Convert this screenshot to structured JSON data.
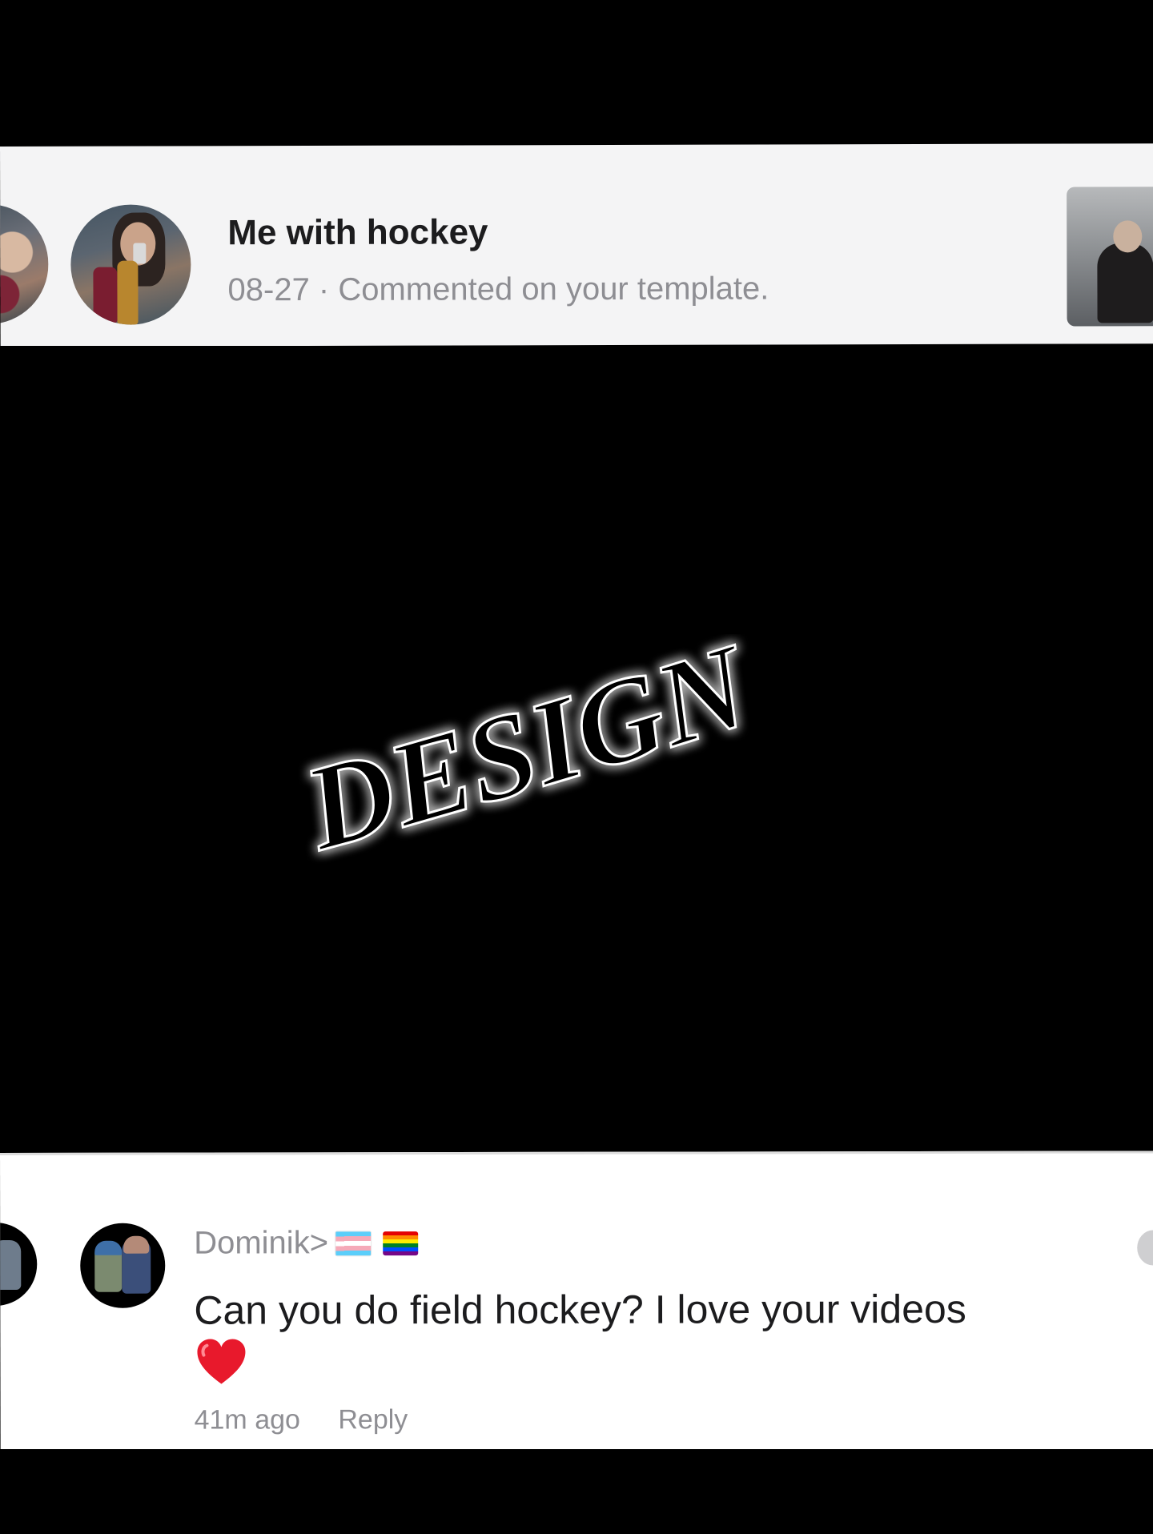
{
  "notification": {
    "title": "Me with hockey",
    "subtitle": "08-27 · Commented on your template.",
    "avatar_icon": "user-photo-avatar",
    "thumbnail_icon": "template-thumbnail"
  },
  "design": {
    "text": "DESIGN",
    "glow_color": "#3bff4a",
    "fill_color": "#000000",
    "outline_color": "#ffffff"
  },
  "comment": {
    "username": "Dominik>",
    "flags": [
      "transgender-flag",
      "rainbow-flag"
    ],
    "text": "Can you do field hockey? I love your videos",
    "emoji": "❤️",
    "time": "41m ago",
    "reply_label": "Reply",
    "avatar_icon": "cartoon-avatar"
  },
  "colors": {
    "card_bg": "#f4f4f5",
    "comment_bg": "#ffffff",
    "secondary_text": "#8e8e93",
    "primary_text": "#1c1c1e",
    "page_bg": "#000000"
  }
}
